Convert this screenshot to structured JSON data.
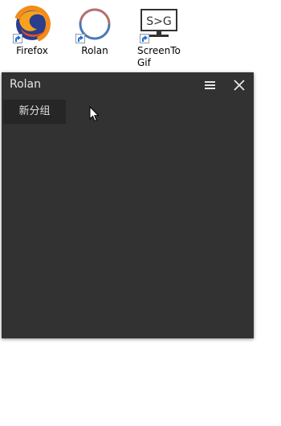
{
  "desktop": {
    "shortcuts": [
      {
        "label": "Firefox",
        "icon": "firefox-icon"
      },
      {
        "label": "Rolan",
        "icon": "rolan-icon"
      },
      {
        "label": "ScreenToGif",
        "icon": "screentogif-icon"
      }
    ]
  },
  "rolan_window": {
    "title": "Rolan",
    "menu_icon": "hamburger-menu-icon",
    "close_icon": "close-icon",
    "groups": [
      {
        "label": "新分组"
      }
    ]
  },
  "colors": {
    "window_bg": "#323232",
    "tab_bg": "#262626",
    "text": "#e6e6e6"
  }
}
